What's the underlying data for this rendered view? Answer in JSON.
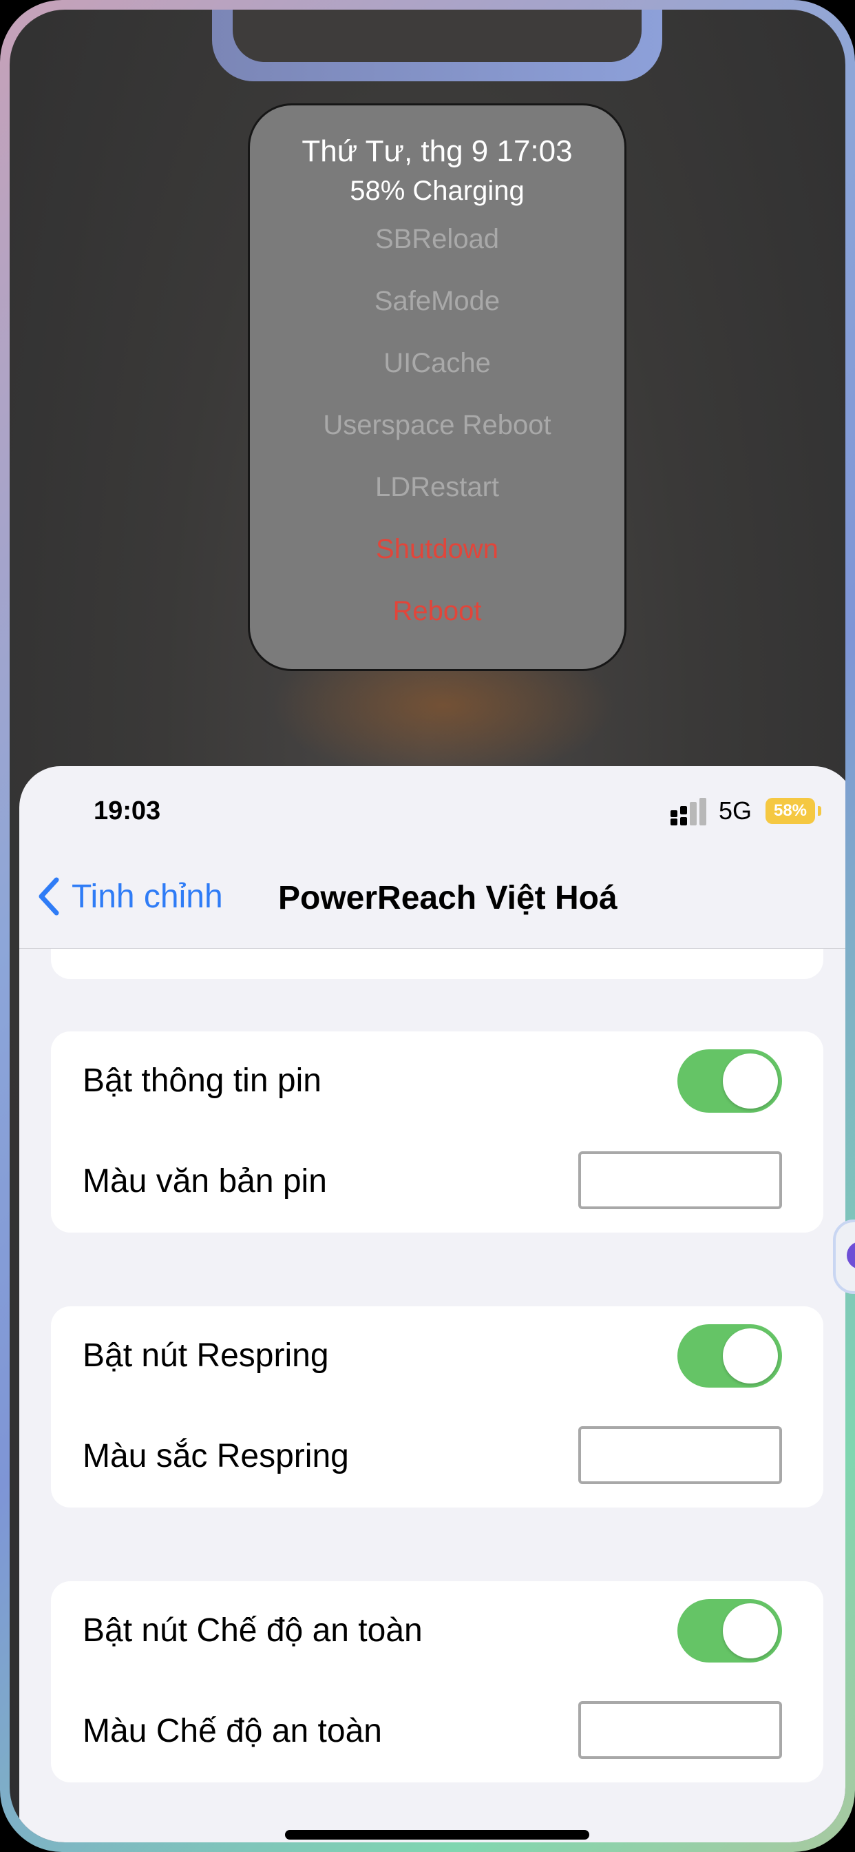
{
  "power_menu": {
    "date_time": "Thứ Tư, thg 9 17:03",
    "battery_status": "58% Charging",
    "items": [
      {
        "label": "SBReload"
      },
      {
        "label": "SafeMode"
      },
      {
        "label": "UICache"
      },
      {
        "label": "Userspace Reboot"
      },
      {
        "label": "LDRestart"
      },
      {
        "label": "Shutdown"
      },
      {
        "label": "Reboot"
      }
    ]
  },
  "status_bar": {
    "time": "19:03",
    "network": "5G",
    "battery": "58%"
  },
  "nav": {
    "back_label": "Tinh chỉnh",
    "title": "PowerReach Việt Hoá"
  },
  "settings": {
    "groups": [
      {
        "toggle_label": "Bật thông tin pin",
        "toggle_on": true,
        "color_label": "Màu văn bản pin"
      },
      {
        "toggle_label": "Bật nút Respring",
        "toggle_on": true,
        "color_label": "Màu sắc Respring"
      },
      {
        "toggle_label": "Bật nút Chế độ an toàn",
        "toggle_on": true,
        "color_label": "Màu Chế độ an toàn"
      }
    ]
  },
  "colors": {
    "accent": "#2f7cf6",
    "toggle_on": "#65c466",
    "danger": "#e2453a",
    "battery_badge": "#f5c842"
  }
}
